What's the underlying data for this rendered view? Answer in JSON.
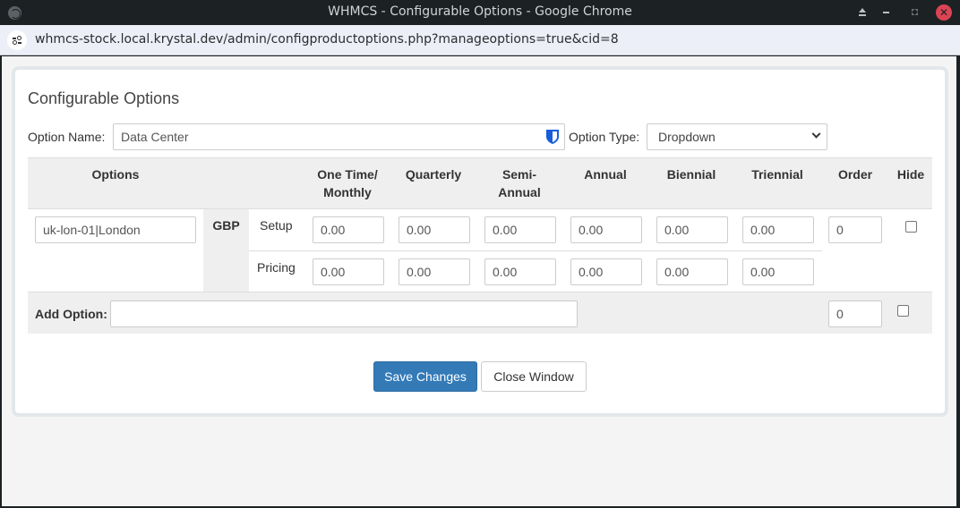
{
  "window": {
    "title": "WHMCS - Configurable Options - Google Chrome",
    "url": "whmcs-stock.local.krystal.dev/admin/configproductoptions.php?manageoptions=true&cid=8"
  },
  "panel": {
    "title": "Configurable Options",
    "option_name_label": "Option Name:",
    "option_name_value": "Data Center",
    "option_type_label": "Option Type:",
    "option_type_value": "Dropdown"
  },
  "table": {
    "headers": {
      "options": "Options",
      "one_time_line1": "One Time/",
      "one_time_line2": "Monthly",
      "quarterly": "Quarterly",
      "semi_line1": "Semi-",
      "semi_line2": "Annual",
      "annual": "Annual",
      "biennial": "Biennial",
      "triennial": "Triennial",
      "order": "Order",
      "hide": "Hide"
    },
    "rows": [
      {
        "option_value": "uk-lon-01|London",
        "currency": "GBP",
        "setup_label": "Setup",
        "pricing_label": "Pricing",
        "setup": [
          "0.00",
          "0.00",
          "0.00",
          "0.00",
          "0.00",
          "0.00"
        ],
        "pricing": [
          "0.00",
          "0.00",
          "0.00",
          "0.00",
          "0.00",
          "0.00"
        ],
        "order": "0",
        "hidden": false
      }
    ],
    "add_option": {
      "label": "Add Option:",
      "value": "",
      "order": "0",
      "hidden": false
    }
  },
  "buttons": {
    "save": "Save Changes",
    "close": "Close Window"
  },
  "colors": {
    "primary": "#337ab7",
    "close_button": "#da4453"
  }
}
